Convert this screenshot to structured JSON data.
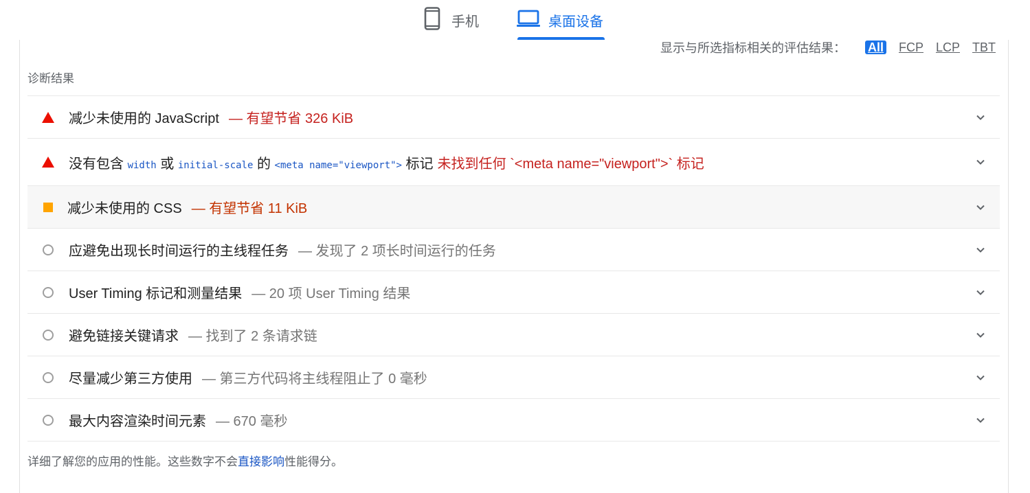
{
  "tabs": {
    "mobile": {
      "label": "手机",
      "icon": "phone-icon"
    },
    "desktop": {
      "label": "桌面设备",
      "icon": "laptop-icon",
      "active": true
    }
  },
  "filter": {
    "label": "显示与所选指标相关的评估结果：",
    "options": [
      "All",
      "FCP",
      "LCP",
      "TBT"
    ],
    "selected": "All"
  },
  "section_title": "诊断结果",
  "audits": [
    {
      "icon": "fail-triangle-icon",
      "title": "减少未使用的 JavaScript",
      "display": "— 有望节省 326 KiB"
    },
    {
      "icon": "fail-triangle-icon",
      "title_before": "没有包含",
      "code1": "width",
      "title_mid1": "或",
      "code2": "initial-scale",
      "title_mid2": "的",
      "code3": "<meta name=\"viewport\">",
      "title_after": "标记",
      "display": "未找到任何 `<meta name=\"viewport\">` 标记"
    },
    {
      "icon": "average-square-icon",
      "title": "减少未使用的 CSS",
      "display": "— 有望节省 11 KiB"
    },
    {
      "icon": "info-circle-icon",
      "title": "应避免出现长时间运行的主线程任务",
      "display": "— 发现了 2 项长时间运行的任务"
    },
    {
      "icon": "info-circle-icon",
      "title": "User Timing 标记和测量结果",
      "display": "— 20 项 User Timing 结果"
    },
    {
      "icon": "info-circle-icon",
      "title": "避免链接关键请求",
      "display": "— 找到了 2 条请求链"
    },
    {
      "icon": "info-circle-icon",
      "title": "尽量减少第三方使用",
      "display": "— 第三方代码将主线程阻止了 0 毫秒"
    },
    {
      "icon": "info-circle-icon",
      "title": "最大内容渲染时间元素",
      "display": "— 670 毫秒"
    }
  ],
  "footer": {
    "before": "详细了解您的应用的性能。这些数字不会",
    "link": "直接影响",
    "after": "性能得分。"
  },
  "colors": {
    "accent": "#1a73e8",
    "fail": "#eb0f00",
    "average": "#ffa400",
    "info": "#9e9e9e"
  }
}
